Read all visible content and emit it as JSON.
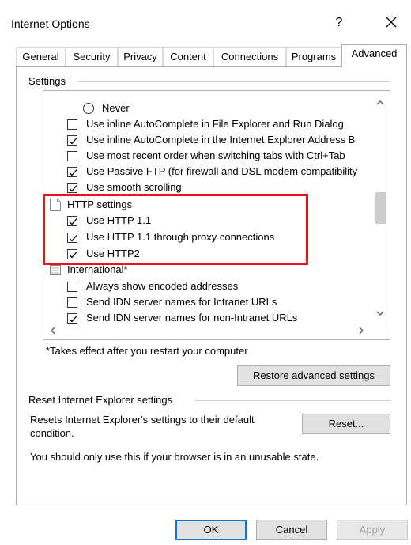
{
  "window": {
    "title": "Internet Options",
    "help_symbol": "?",
    "close_symbol": "✕"
  },
  "tabs": [
    {
      "label": "General"
    },
    {
      "label": "Security"
    },
    {
      "label": "Privacy"
    },
    {
      "label": "Content"
    },
    {
      "label": "Connections"
    },
    {
      "label": "Programs"
    },
    {
      "label": "Advanced",
      "active": true
    }
  ],
  "settings": {
    "group_label": "Settings",
    "items": [
      {
        "type": "radio",
        "label": "Never",
        "checked": false
      },
      {
        "type": "checkbox",
        "label": "Use inline AutoComplete in File Explorer and Run Dialog",
        "checked": false
      },
      {
        "type": "checkbox",
        "label": "Use inline AutoComplete in the Internet Explorer Address B",
        "checked": true
      },
      {
        "type": "checkbox",
        "label": "Use most recent order when switching tabs with Ctrl+Tab",
        "checked": false
      },
      {
        "type": "checkbox",
        "label": "Use Passive FTP (for firewall and DSL modem compatibility",
        "checked": true
      },
      {
        "type": "checkbox",
        "label": "Use smooth scrolling",
        "checked": true
      },
      {
        "type": "category",
        "label": "HTTP settings"
      },
      {
        "type": "checkbox",
        "label": "Use HTTP 1.1",
        "checked": true
      },
      {
        "type": "checkbox",
        "label": "Use HTTP 1.1 through proxy connections",
        "checked": true
      },
      {
        "type": "checkbox",
        "label": "Use HTTP2",
        "checked": true
      },
      {
        "type": "category",
        "label": "International*"
      },
      {
        "type": "checkbox",
        "label": "Always show encoded addresses",
        "checked": false
      },
      {
        "type": "checkbox",
        "label": "Send IDN server names for Intranet URLs",
        "checked": false
      },
      {
        "type": "checkbox",
        "label": "Send IDN server names for non-Intranet URLs",
        "checked": true
      }
    ],
    "footnote": "*Takes effect after you restart your computer",
    "restore_button": "Restore advanced settings"
  },
  "reset": {
    "group_label": "Reset Internet Explorer settings",
    "description": "Resets Internet Explorer's settings to their default",
    "description_line2": "condition.",
    "reset_button": "Reset...",
    "warning": "You should only use this if your browser is in an unusable state."
  },
  "footer": {
    "ok_label": "OK",
    "cancel_label": "Cancel",
    "apply_label": "Apply"
  },
  "colors": {
    "highlight_border": "#e8141c",
    "default_button_border": "#0078d7"
  }
}
